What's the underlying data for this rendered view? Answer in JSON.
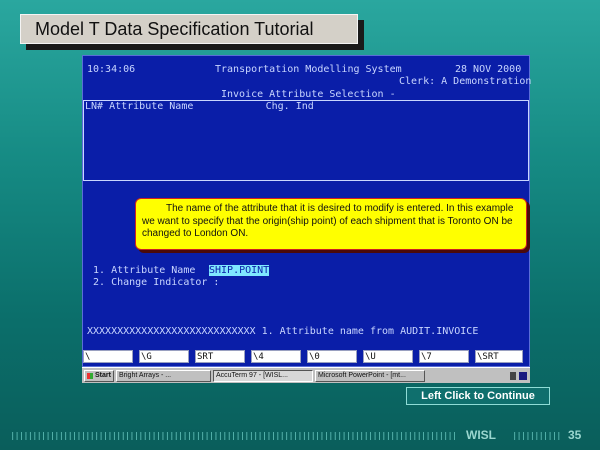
{
  "slide": {
    "title": "Model T Data Specification Tutorial",
    "continue_label": "Left Click to Continue",
    "footer_org": "WISL",
    "page_number": "35"
  },
  "terminal": {
    "time": "10:34:06",
    "system": "Transportation Modelling System",
    "date": "28 NOV 2000",
    "clerk": "Clerk: A Demonstration",
    "screen_title": "Invoice Attribute Selection -",
    "col_header": "LN# Attribute Name            Chg. Ind",
    "field1_label": " 1. Attribute Name    :",
    "field1_value": "SHIP.POINT",
    "field2_label": " 2. Change Indicator :",
    "status_line": "XXXXXXXXXXXXXXXXXXXXXXXXXXXX 1. Attribute name from AUDIT.INVOICE",
    "fkeys": [
      "\\",
      "\\G",
      "SRT",
      "\\4",
      "\\0",
      "\\U",
      "\\7",
      "\\SRT"
    ]
  },
  "note": {
    "text": "The name of the attribute that it is desired to modify is entered. In this example we want to specify that the origin(ship point) of each shipment that is Toronto ON be changed to London ON."
  },
  "taskbar": {
    "start": "Start",
    "items": [
      "Bright Arrays - ...",
      "AccuTerm 97 - [WISL...",
      "Microsoft PowerPoint - [mt..."
    ]
  },
  "colors": {
    "background": "#168b84",
    "terminal_bg": "#0a1ea8",
    "note_bg": "#ffff00",
    "highlight": "#7fe7ff"
  }
}
